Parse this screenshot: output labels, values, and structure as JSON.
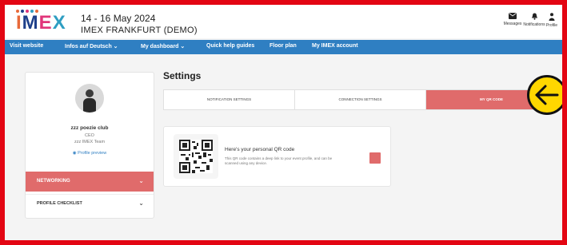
{
  "header": {
    "logo_text": [
      "I",
      "M",
      "E",
      "X"
    ],
    "event_date": "14 - 16 May 2024",
    "event_name": "IMEX FRANKFURT (DEMO)",
    "icons": [
      {
        "name": "messages-icon",
        "label": "Messages"
      },
      {
        "name": "notifications-icon",
        "label": "Notifications"
      },
      {
        "name": "profile-icon",
        "label": "Profile"
      }
    ]
  },
  "nav": {
    "items": [
      {
        "label": "Visit website"
      },
      {
        "label": "Infos auf Deutsch ⌄"
      },
      {
        "label": "My dashboard ⌄"
      },
      {
        "label": "Quick help guides"
      },
      {
        "label": "Floor plan"
      },
      {
        "label": "My IMEX account"
      }
    ]
  },
  "sidebar": {
    "name": "zzz poezie club",
    "role": "CEO",
    "organisation": "zzz IMEX Team",
    "preview_link": "Profile preview",
    "items": [
      {
        "label": "NETWORKING",
        "chevron": "⌄"
      },
      {
        "label": "PROFILE CHECKLIST",
        "chevron": "⌄"
      }
    ]
  },
  "settings": {
    "title": "Settings",
    "tabs": [
      {
        "label": "NOTIFICATION SETTINGS"
      },
      {
        "label": "CONNECTION SETTINGS"
      },
      {
        "label": "MY QR CODE"
      }
    ],
    "qr_card": {
      "title": "Here's your personal QR code",
      "description": "This QR code contains a deep link to your event profile, and can be scanned using any device."
    }
  },
  "colors": {
    "brand_red": "#e30613",
    "nav_blue": "#2f7fc2",
    "accent_coral": "#e06b6b",
    "highlight_yellow": "#ffd700"
  }
}
